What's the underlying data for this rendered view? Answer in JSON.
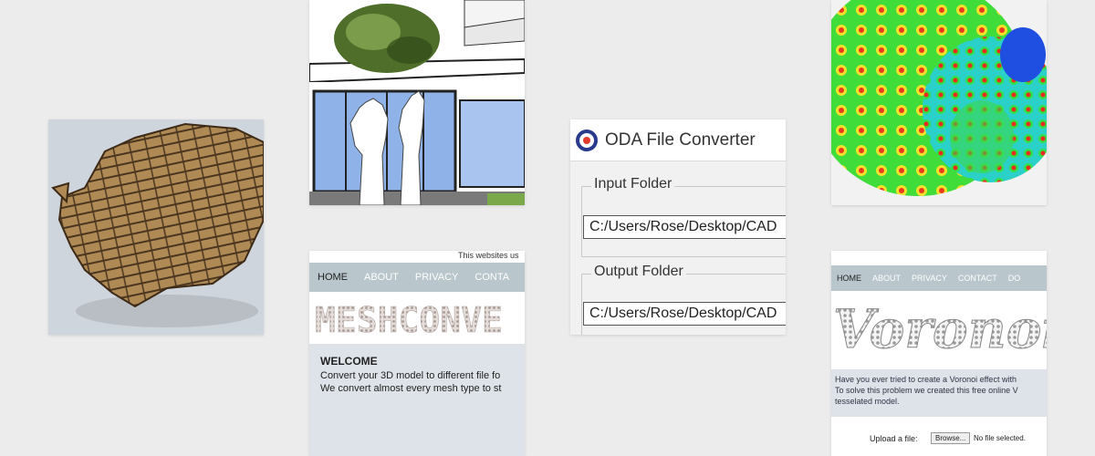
{
  "oda": {
    "title": "ODA File Converter",
    "input_label": "Input Folder",
    "input_value": "C:/Users/Rose/Desktop/CAD",
    "output_label": "Output Folder",
    "output_value": "C:/Users/Rose/Desktop/CAD"
  },
  "mesh": {
    "cookie_text": "This websites us",
    "nav": [
      "HOME",
      "ABOUT",
      "PRIVACY",
      "CONTA"
    ],
    "banner_text": "MESHCONVE",
    "welcome_title": "WELCOME",
    "welcome_line1": "Convert your 3D model to different file fo",
    "welcome_line2": "We convert almost every mesh type to st"
  },
  "voronoi": {
    "nav": [
      "HOME",
      "ABOUT",
      "PRIVACY",
      "CONTACT",
      "DO"
    ],
    "banner_text": "Voronoi",
    "desc_line1": "Have you ever tried to create a Voronoi effect with",
    "desc_line2": "To solve this problem we created this free online V",
    "desc_line3": "tesselated model.",
    "upload_label": "Upload a file:",
    "browse_label": "Browse...",
    "no_file_text": "No file selected."
  },
  "colors": {
    "page_bg": "#ececec",
    "nav_bg": "#b9c6cc",
    "cardboard": "#b08a54",
    "oda_logo": "#2a3a8c"
  }
}
